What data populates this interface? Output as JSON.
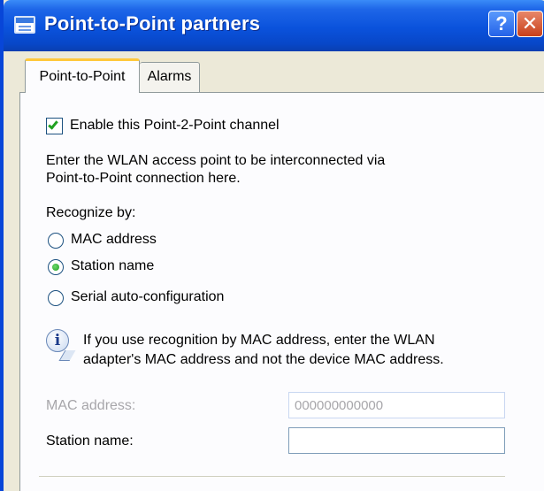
{
  "window": {
    "title": "Point-to-Point partners",
    "help_label": "?",
    "close_label": "✕"
  },
  "tabs": [
    {
      "label": "Point-to-Point",
      "active": true
    },
    {
      "label": "Alarms",
      "active": false
    }
  ],
  "enable_checkbox": {
    "label": "Enable this Point-2-Point channel",
    "checked": true
  },
  "description": [
    "Enter the WLAN access point to be interconnected via",
    "Point-to-Point connection here."
  ],
  "recognize": {
    "heading": "Recognize by:",
    "options": [
      {
        "label": "MAC address",
        "selected": false
      },
      {
        "label": "Station name",
        "selected": true
      },
      {
        "label": "Serial auto-configuration",
        "selected": false
      }
    ]
  },
  "info": {
    "icon": "info-icon",
    "lines": [
      "If you use recognition by MAC address, enter the WLAN",
      "adapter's MAC address and not the device MAC address."
    ]
  },
  "fields": {
    "mac": {
      "label": "MAC address:",
      "value": "000000000000",
      "disabled": true
    },
    "station": {
      "label": "Station name:",
      "value": "",
      "disabled": false
    }
  },
  "colors": {
    "titlebar": "#0A52DC",
    "dialog_bg": "#ECE9D8",
    "active_tab_accent": "#FFC83C",
    "check_green": "#21A121"
  }
}
